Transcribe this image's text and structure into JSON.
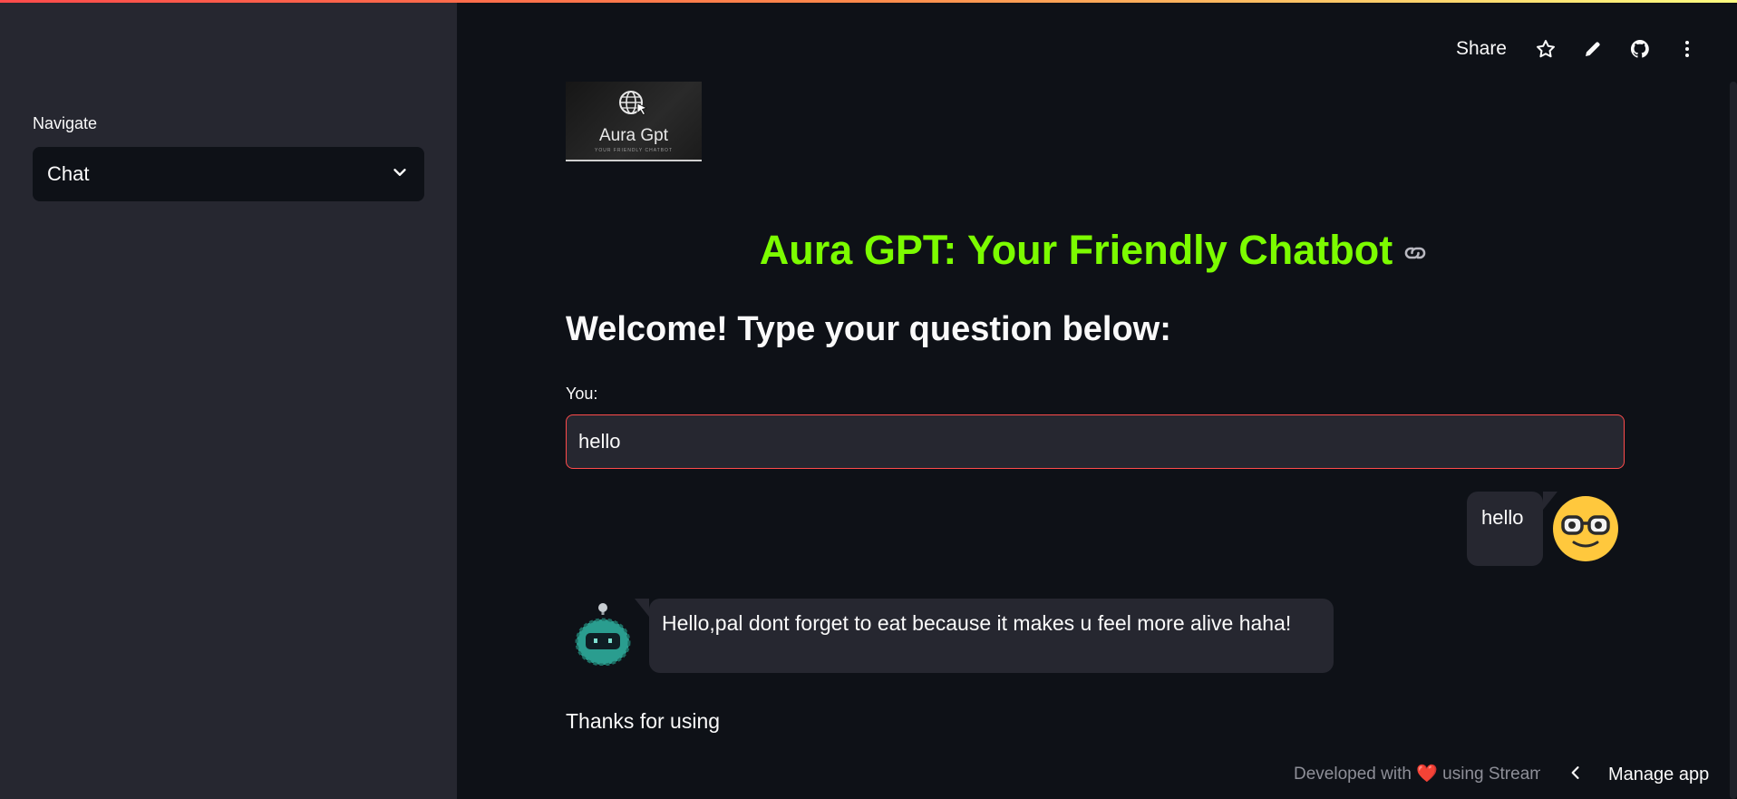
{
  "sidebar": {
    "nav_label": "Navigate",
    "select_value": "Chat"
  },
  "toolbar": {
    "share_label": "Share",
    "icons": [
      "star-icon",
      "pencil-icon",
      "github-icon",
      "more-vertical-icon"
    ]
  },
  "logo": {
    "text": "Aura Gpt",
    "subtext": "YOUR FRIENDLY CHATBOT"
  },
  "main": {
    "title": "Aura GPT: Your Friendly Chatbot",
    "welcome": "Welcome! Type your question below:",
    "input_label": "You:",
    "input_value": "hello",
    "thanks": "Thanks for using"
  },
  "chat": {
    "user_message": "hello",
    "bot_message": "Hello,pal dont forget to eat because it makes u feel more alive haha!"
  },
  "footer": {
    "developed_prefix": "Developed with",
    "developed_suffix": "using Streamlit",
    "manage_label": "Manage app"
  },
  "colors": {
    "background": "#0e1117",
    "sidebar": "#262730",
    "title_green": "#7cfc00",
    "input_border": "#ff4b4b"
  }
}
